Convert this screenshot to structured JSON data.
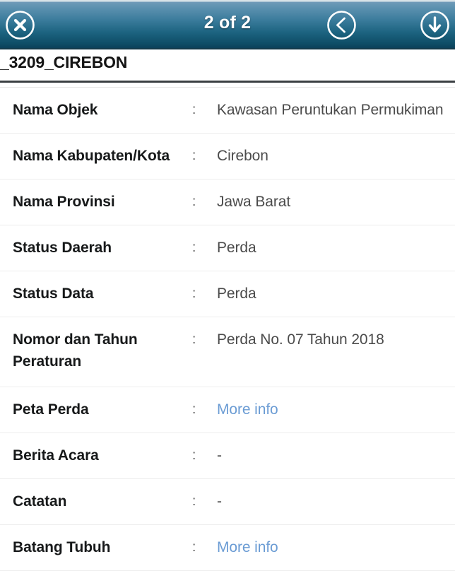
{
  "header": {
    "title": "2 of 2",
    "close_icon": "close-circle-icon",
    "back_icon": "chevron-left-circle-icon",
    "download_icon": "download-circle-icon",
    "gradient_top_color": "#6f9ab8",
    "gradient_bottom_color": "#0b415a"
  },
  "document": {
    "title": "_3209_CIREBON"
  },
  "colors": {
    "link": "#6b9cd4",
    "label": "#17191a",
    "value": "#4b4b4b",
    "separator": "#ededed"
  },
  "info": {
    "colon": ":",
    "rows": [
      {
        "label": "Nama Objek",
        "value": "Kawasan Peruntukan Permukiman",
        "is_link": false
      },
      {
        "label": "Nama Kabupaten/Kota",
        "value": "Cirebon",
        "is_link": false
      },
      {
        "label": "Nama Provinsi",
        "value": "Jawa Barat",
        "is_link": false
      },
      {
        "label": "Status Daerah",
        "value": "Perda",
        "is_link": false
      },
      {
        "label": "Status Data",
        "value": "Perda",
        "is_link": false
      },
      {
        "label": "Nomor dan Tahun Peraturan",
        "value": "Perda No. 07 Tahun 2018",
        "is_link": false
      },
      {
        "label": "Peta Perda",
        "value": "More info",
        "is_link": true
      },
      {
        "label": "Berita Acara",
        "value": "-",
        "is_link": false
      },
      {
        "label": "Catatan",
        "value": "-",
        "is_link": false
      },
      {
        "label": "Batang Tubuh",
        "value": "More info",
        "is_link": true
      }
    ]
  }
}
